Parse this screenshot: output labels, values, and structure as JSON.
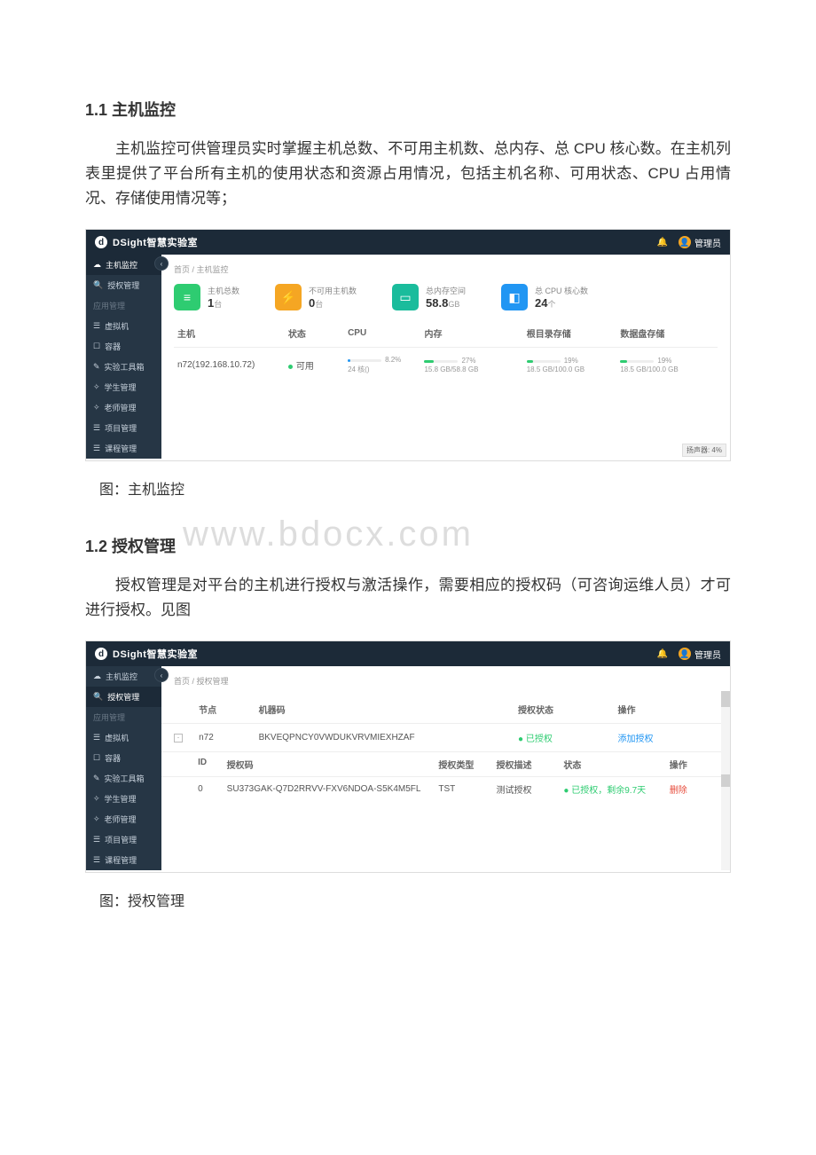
{
  "doc": {
    "section1_heading": "1.1 主机监控",
    "section1_body": "主机监控可供管理员实时掌握主机总数、不可用主机数、总内存、总 CPU 核心数。在主机列表里提供了平台所有主机的使用状态和资源占用情况，包括主机名称、可用状态、CPU 占用情况、存储使用情况等；",
    "caption1": "图：主机监控",
    "watermark": "www.bdocx.com",
    "section2_heading": "1.2 授权管理",
    "section2_body": "授权管理是对平台的主机进行授权与激活操作，需要相应的授权码（可咨询运维人员）才可进行授权。见图",
    "caption2": "图：授权管理"
  },
  "brand": {
    "badge": "d",
    "name": "DSight智慧实验室"
  },
  "topbar": {
    "user_label": "管理员"
  },
  "sidebar": {
    "items": [
      {
        "icon": "☁",
        "label": "主机监控"
      },
      {
        "icon": "🔍",
        "label": "授权管理"
      }
    ],
    "section_label": "应用管理",
    "items2": [
      {
        "icon": "☰",
        "label": "虚拟机"
      },
      {
        "icon": "☐",
        "label": "容器"
      },
      {
        "icon": "✎",
        "label": "实验工具箱"
      },
      {
        "icon": "✧",
        "label": "学生管理"
      },
      {
        "icon": "✧",
        "label": "老师管理"
      },
      {
        "icon": "☰",
        "label": "项目管理"
      },
      {
        "icon": "☰",
        "label": "课程管理"
      }
    ]
  },
  "shot1": {
    "breadcrumb": "首页 / 主机监控",
    "stats": [
      {
        "label": "主机总数",
        "value": "1",
        "unit": "台"
      },
      {
        "label": "不可用主机数",
        "value": "0",
        "unit": "台"
      },
      {
        "label": "总内存空间",
        "value": "58.8",
        "unit": "GB"
      },
      {
        "label": "总 CPU 核心数",
        "value": "24",
        "unit": "个"
      }
    ],
    "columns": {
      "c0": "主机",
      "c1": "状态",
      "c2": "CPU",
      "c3": "内存",
      "c4": "根目录存储",
      "c5": "数据盘存储"
    },
    "row": {
      "host": "n72(192.168.10.72)",
      "status": "可用",
      "cpu_cores": "24 核()",
      "cpu_pct": "8.2%",
      "mem_text": "15.8 GB/58.8 GB",
      "mem_pct": "27%",
      "root_text": "18.5 GB/100.0 GB",
      "root_pct": "19%",
      "data_text": "18.5 GB/100.0 GB",
      "data_pct": "19%"
    },
    "footer": "扬声器: 4%"
  },
  "shot2": {
    "breadcrumb": "首页 / 授权管理",
    "head": {
      "c0": "",
      "c1": "节点",
      "c2": "机器码",
      "c3": "授权状态",
      "c4": "操作"
    },
    "row1": {
      "expand": "-",
      "node": "n72",
      "machine_code": "BKVEQPNCY0VWDUKVRVMIEXHZAF",
      "status": "● 已授权",
      "action": "添加授权"
    },
    "head2": {
      "c0": "",
      "c1": "ID",
      "c2": "授权码",
      "c3": "授权类型",
      "c4": "授权描述",
      "c5": "状态",
      "c6": "操作"
    },
    "row2": {
      "id": "0",
      "code": "SU373GAK-Q7D2RRVV-FXV6NDOA-S5K4M5FL",
      "type": "TST",
      "desc": "测试授权",
      "status": "● 已授权，剩余9.7天",
      "action": "删除"
    }
  }
}
